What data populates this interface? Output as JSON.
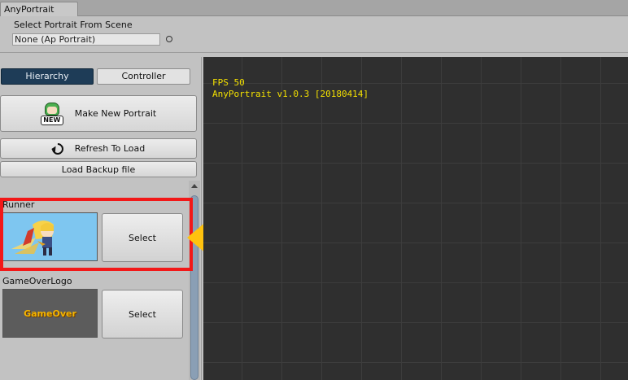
{
  "window": {
    "tab_title": "AnyPortrait"
  },
  "header": {
    "select_label": "Select Portrait From Scene",
    "object_field_value": "None (Ap Portrait)"
  },
  "left_panel": {
    "tabs": [
      {
        "label": "Hierarchy",
        "active": true
      },
      {
        "label": "Controller",
        "active": false
      }
    ],
    "buttons": {
      "make_new_portrait": "Make New Portrait",
      "make_new_badge": "NEW",
      "refresh_to_load": "Refresh To Load",
      "load_backup": "Load Backup file"
    },
    "items": [
      {
        "name": "Runner",
        "select_label": "Select"
      },
      {
        "name": "GameOverLogo",
        "thumb_text": "GameOver",
        "select_label": "Select"
      }
    ]
  },
  "viewport": {
    "fps": "FPS 50",
    "version": "AnyPortrait v1.0.3 [20180414]"
  },
  "colors": {
    "highlight": "#f21818",
    "arrow": "#ffc20e",
    "overlay_text": "#f3e000",
    "active_tab": "#1e3c57"
  }
}
